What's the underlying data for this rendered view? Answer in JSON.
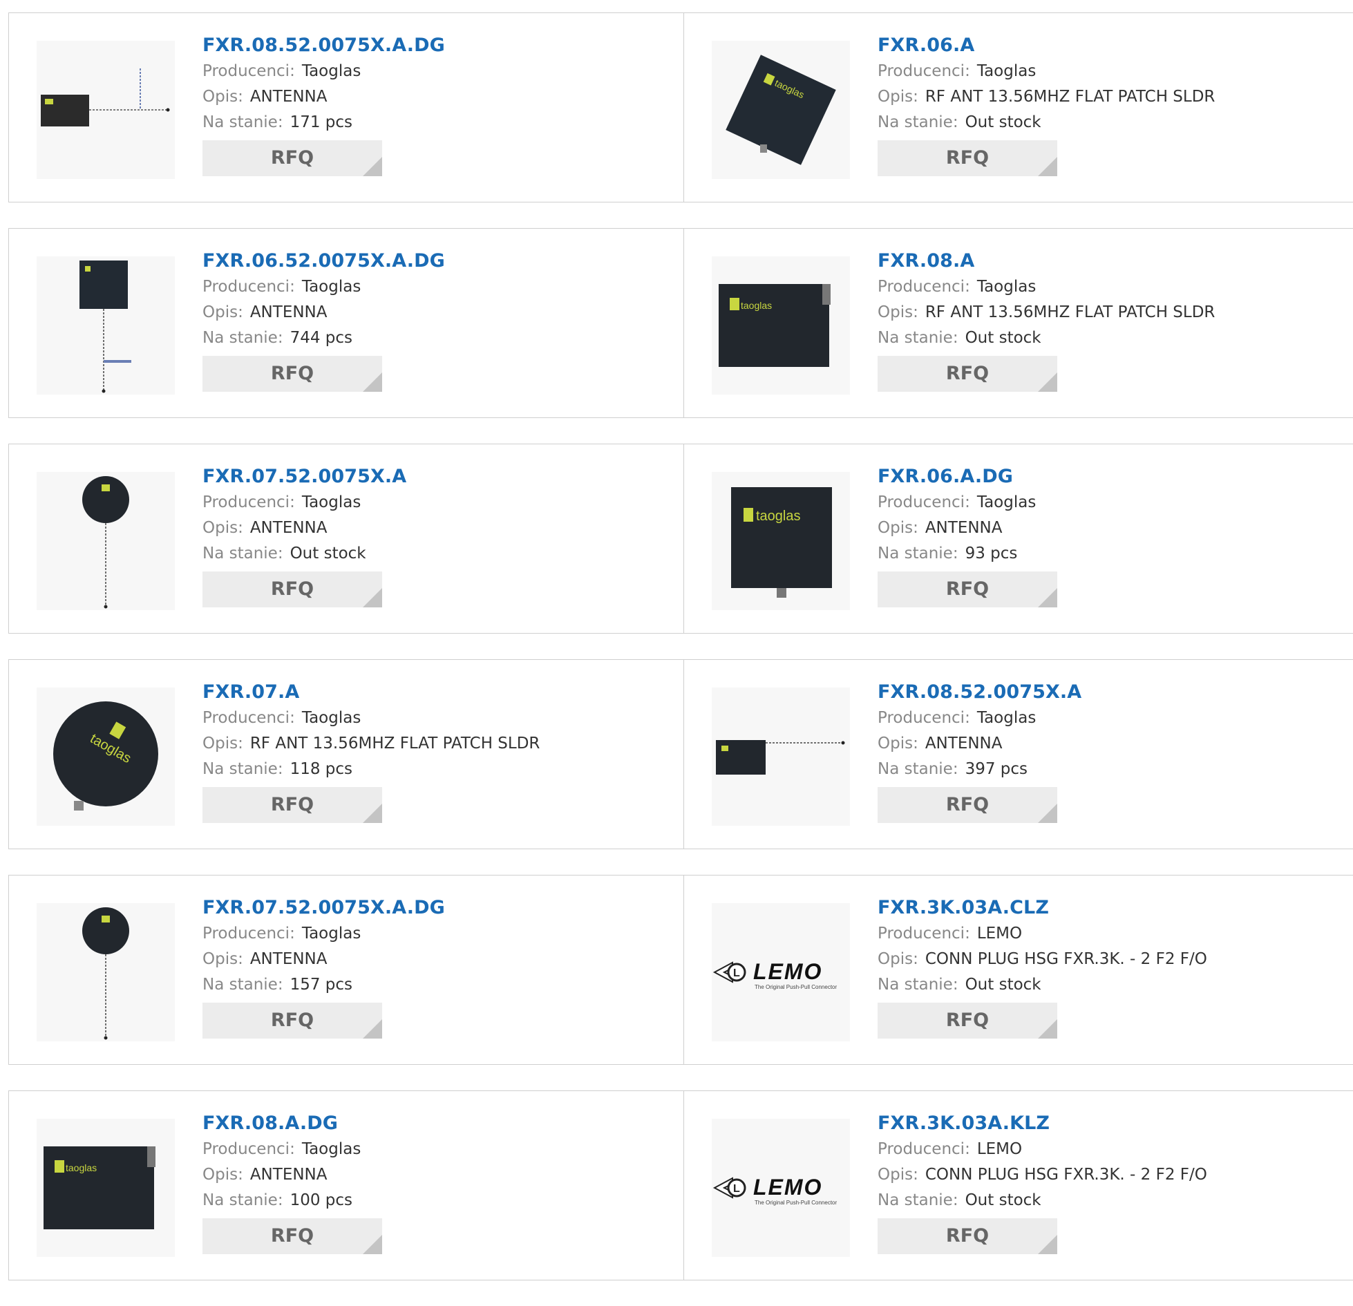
{
  "labels": {
    "manufacturer": "Producenci:",
    "description": "Opis:",
    "stock": "Na stanie:",
    "rfq": "RFQ"
  },
  "products": [
    {
      "pn": "FXR.08.52.0075X.A.DG",
      "manufacturer": "Taoglas",
      "description": "ANTENNA",
      "stock": "171 pcs",
      "image": "patch-with-tee-cable"
    },
    {
      "pn": "FXR.06.A",
      "manufacturer": "Taoglas",
      "description": "RF ANT 13.56MHZ FLAT PATCH SLDR",
      "stock": "Out stock",
      "image": "square-patch-tilted"
    },
    {
      "pn": "FXR.06.52.0075X.A.DG",
      "manufacturer": "Taoglas",
      "description": "ANTENNA",
      "stock": "744 pcs",
      "image": "square-patch-with-cable"
    },
    {
      "pn": "FXR.08.A",
      "manufacturer": "Taoglas",
      "description": "RF ANT 13.56MHZ FLAT PATCH SLDR",
      "stock": "Out stock",
      "image": "rect-patch"
    },
    {
      "pn": "FXR.07.52.0075X.A",
      "manufacturer": "Taoglas",
      "description": "ANTENNA",
      "stock": "Out stock",
      "image": "round-patch-with-cable"
    },
    {
      "pn": "FXR.06.A.DG",
      "manufacturer": "Taoglas",
      "description": "ANTENNA",
      "stock": "93 pcs",
      "image": "square-patch"
    },
    {
      "pn": "FXR.07.A",
      "manufacturer": "Taoglas",
      "description": "RF ANT 13.56MHZ FLAT PATCH SLDR",
      "stock": "118 pcs",
      "image": "round-patch"
    },
    {
      "pn": "FXR.08.52.0075X.A",
      "manufacturer": "Taoglas",
      "description": "ANTENNA",
      "stock": "397 pcs",
      "image": "patch-with-side-cable"
    },
    {
      "pn": "FXR.07.52.0075X.A.DG",
      "manufacturer": "Taoglas",
      "description": "ANTENNA",
      "stock": "157 pcs",
      "image": "round-patch-with-cable"
    },
    {
      "pn": "FXR.3K.03A.CLZ",
      "manufacturer": "LEMO",
      "description": "CONN PLUG HSG FXR.3K. - 2 F2 F/O",
      "stock": "Out stock",
      "image": "lemo-logo"
    },
    {
      "pn": "FXR.08.A.DG",
      "manufacturer": "Taoglas",
      "description": "ANTENNA",
      "stock": "100 pcs",
      "image": "rect-patch"
    },
    {
      "pn": "FXR.3K.03A.KLZ",
      "manufacturer": "LEMO",
      "description": "CONN PLUG HSG FXR.3K. - 2 F2 F/O",
      "stock": "Out stock",
      "image": "lemo-logo"
    }
  ]
}
